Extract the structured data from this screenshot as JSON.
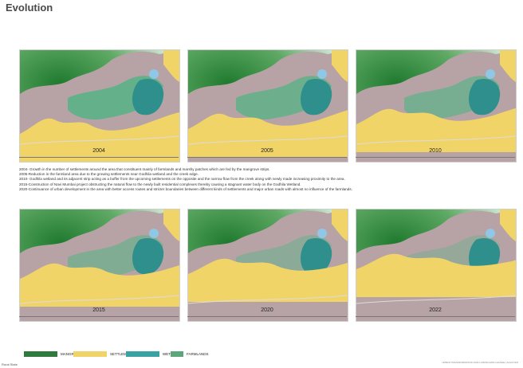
{
  "page": {
    "title": "Evolution"
  },
  "panels": [
    {
      "year": "2004"
    },
    {
      "year": "2005"
    },
    {
      "year": "2010"
    },
    {
      "year": "2015"
    },
    {
      "year": "2020"
    },
    {
      "year": "2022"
    }
  ],
  "notes": [
    "2004- Growth in the number of settlements around the area that constituent mainly of farmlands and marshy patches which are fed by the mangrove strips.",
    "2005-Reduction in the farmland area due to the growing settlements near Godhila wetland and the creek edge.",
    "2010- Godhila wetland and its adjacent strip acting as a buffer from the upcoming settlements on the opposite and the narrow flow from the creek along with newly made increasing proximity to the area.",
    "2015-Construction of Navi Mumbai project obstructing the natural flow to the newly built residential complexes thereby causing a stagnant water body on the Godhila Wetland.",
    "2020-Continuance of urban development in the area with better access routes and stricter boundaries between different kinds of settlements and major urban roads with almost no influence of the farmlands."
  ],
  "legend": [
    {
      "label": "MANGROVES",
      "color": "#2f7a3c"
    },
    {
      "label": "SETTLEMENTS",
      "color": "#f1d468"
    },
    {
      "label": "WETLANDS",
      "color": "#3aa2a3"
    },
    {
      "label": "FARMLANDS",
      "color": "#5ca779"
    }
  ],
  "colors": {
    "mangrove_dark": "#1f7a2e",
    "mangrove_light": "#d9eedc",
    "land": "#b7a3a6",
    "settlement": "#f1d468",
    "wetland": "#2f8f8c",
    "farmland": "#63b08a",
    "water": "#8fc8e6"
  },
  "footer": {
    "left": "Rural Slate",
    "right": "URBAN TRANSFORMATION AND LANDSCAPE CHANGE | ANALYSIS"
  }
}
